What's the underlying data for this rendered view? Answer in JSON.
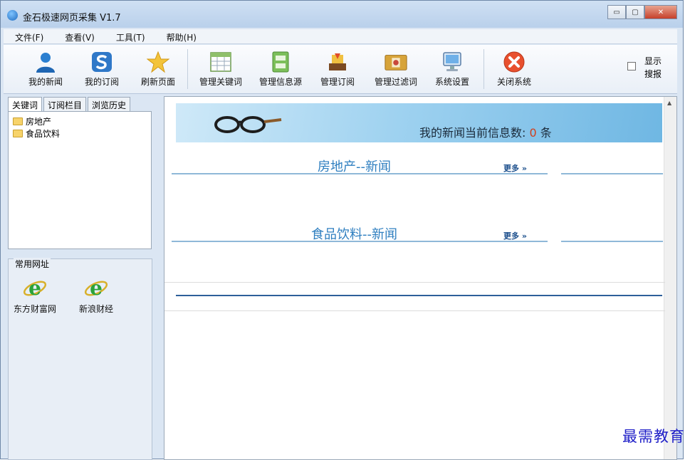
{
  "window": {
    "title": "金石极速网页采集 V1.7",
    "minimize": "▭",
    "maximize": "▢",
    "close": "✕"
  },
  "menu": [
    "文件(F)",
    "查看(V)",
    "工具(T)",
    "帮助(H)"
  ],
  "toolbar": {
    "buttons": [
      {
        "label": "我的新闻",
        "icon": "user-icon"
      },
      {
        "label": "我的订阅",
        "icon": "subscribe-icon"
      },
      {
        "label": "刷新页面",
        "icon": "star-icon"
      },
      {
        "label": "管理关键词",
        "icon": "table-icon"
      },
      {
        "label": "管理信息源",
        "icon": "cabinet-icon"
      },
      {
        "label": "管理订阅",
        "icon": "inbox-icon"
      },
      {
        "label": "管理过滤词",
        "icon": "folder-icon"
      },
      {
        "label": "系统设置",
        "icon": "monitor-icon"
      },
      {
        "label": "关闭系统",
        "icon": "close-red-icon"
      }
    ],
    "show_search_label": "显示搜报"
  },
  "left_tabs": [
    "关键词",
    "订阅栏目",
    "浏览历史"
  ],
  "tree_items": [
    "房地产",
    "食品饮料"
  ],
  "sites": {
    "title": "常用网址",
    "items": [
      "东方财富网",
      "新浪财经"
    ]
  },
  "content": {
    "banner_prefix": "我的新闻当前信息数:",
    "banner_count": "0",
    "banner_suffix": "条",
    "sections": [
      {
        "title": "房地产--新闻",
        "more": "更多 »"
      },
      {
        "title": "食品饮料--新闻",
        "more": "更多 »"
      }
    ]
  },
  "watermark": "最需教育",
  "colors": {
    "accent": "#2f7fc0",
    "count_red": "#d0401e",
    "title_bg": "#cfe0f3"
  }
}
